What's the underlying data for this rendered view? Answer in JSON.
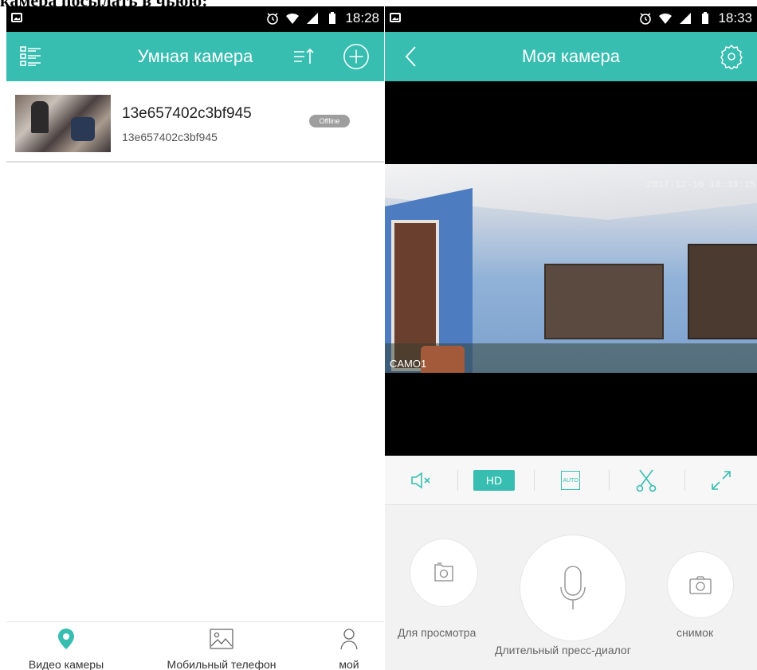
{
  "caption": "камера посылать в чьюю:",
  "left": {
    "status": {
      "time": "18:28"
    },
    "appbar": {
      "title": "Умная камера"
    },
    "camera": {
      "name": "13e657402c3bf945",
      "id": "13e657402c3bf945",
      "status": "Offline"
    },
    "nav": [
      {
        "label": "Видео камеры",
        "icon": "location-pin-icon",
        "active": true
      },
      {
        "label": "Мобильный телефон",
        "icon": "gallery-icon",
        "active": false
      },
      {
        "label": "мой",
        "icon": "profile-icon",
        "active": false
      }
    ]
  },
  "right": {
    "status": {
      "time": "18:33"
    },
    "appbar": {
      "title": "Моя камера"
    },
    "video": {
      "timestamp": "2017-12-10 18:33:15",
      "camera_label": "CAMO1"
    },
    "controls": {
      "hd_label": "HD",
      "auto_label": "AUTO"
    },
    "actions": {
      "browse_label": "Для просмотра",
      "talk_label": "Длительный пресс-диалог",
      "snapshot_label": "снимок"
    }
  },
  "colors": {
    "accent": "#37beb0",
    "badge": "#9e9e9e"
  }
}
